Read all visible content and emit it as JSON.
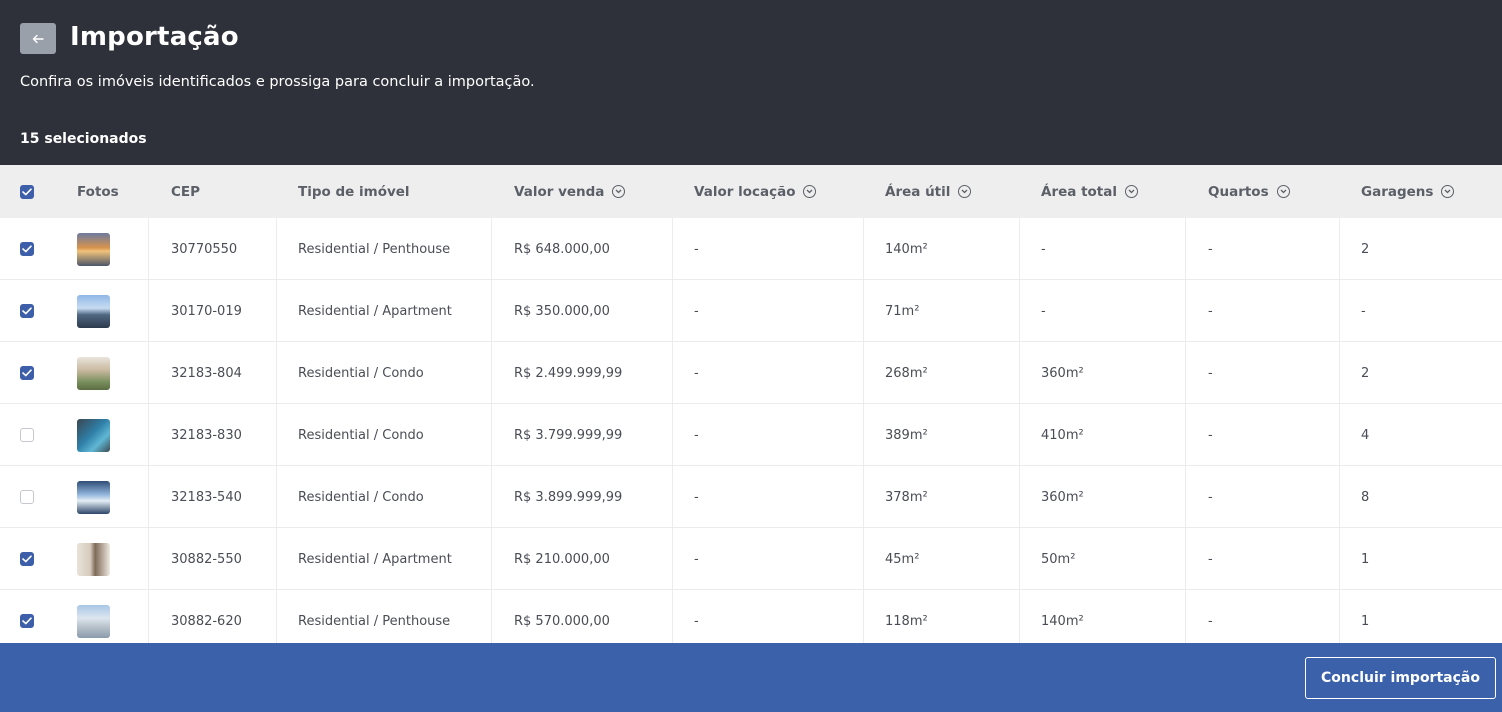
{
  "header": {
    "title": "Importação",
    "subtitle": "Confira os imóveis identificados e prossiga para concluir a importação.",
    "selected_count": "15 selecionados"
  },
  "table": {
    "columns": {
      "fotos": "Fotos",
      "cep": "CEP",
      "tipo": "Tipo de imóvel",
      "valor_venda": "Valor venda",
      "valor_locacao": "Valor locação",
      "area_util": "Área útil",
      "area_total": "Área total",
      "quartos": "Quartos",
      "garagens": "Garagens"
    },
    "header_checked": true,
    "rows": [
      {
        "checked": true,
        "photo": "sunset-building-photo",
        "cep": "30770550",
        "tipo": "Residential / Penthouse",
        "valor_venda": "R$ 648.000,00",
        "valor_locacao": "-",
        "area_util": "140m²",
        "area_total": "-",
        "quartos": "-",
        "garagens": "2"
      },
      {
        "checked": true,
        "photo": "city-skyline-photo",
        "cep": "30170-019",
        "tipo": "Residential / Apartment",
        "valor_venda": "R$ 350.000,00",
        "valor_locacao": "-",
        "area_util": "71m²",
        "area_total": "-",
        "quartos": "-",
        "garagens": "-"
      },
      {
        "checked": true,
        "photo": "condo-facade-photo",
        "cep": "32183-804",
        "tipo": "Residential / Condo",
        "valor_venda": "R$ 2.499.999,99",
        "valor_locacao": "-",
        "area_util": "268m²",
        "area_total": "360m²",
        "quartos": "-",
        "garagens": "2"
      },
      {
        "checked": false,
        "photo": "pool-photo",
        "cep": "32183-830",
        "tipo": "Residential / Condo",
        "valor_venda": "R$ 3.799.999,99",
        "valor_locacao": "-",
        "area_util": "389m²",
        "area_total": "410m²",
        "quartos": "-",
        "garagens": "4"
      },
      {
        "checked": false,
        "photo": "glass-building-photo",
        "cep": "32183-540",
        "tipo": "Residential / Condo",
        "valor_venda": "R$ 3.899.999,99",
        "valor_locacao": "-",
        "area_util": "378m²",
        "area_total": "360m²",
        "quartos": "-",
        "garagens": "8"
      },
      {
        "checked": true,
        "photo": "interior-room-photo",
        "cep": "30882-550",
        "tipo": "Residential / Apartment",
        "valor_venda": "R$ 210.000,00",
        "valor_locacao": "-",
        "area_util": "45m²",
        "area_total": "50m²",
        "quartos": "-",
        "garagens": "1"
      },
      {
        "checked": true,
        "photo": "terrace-photo",
        "cep": "30882-620",
        "tipo": "Residential / Penthouse",
        "valor_venda": "R$ 570.000,00",
        "valor_locacao": "-",
        "area_util": "118m²",
        "area_total": "140m²",
        "quartos": "-",
        "garagens": "1"
      }
    ]
  },
  "footer": {
    "finish_label": "Concluir importação"
  },
  "colors": {
    "header_bg": "#2e3139",
    "footer_bg": "#3b61aa",
    "checkbox_on": "#3d5ea8"
  }
}
